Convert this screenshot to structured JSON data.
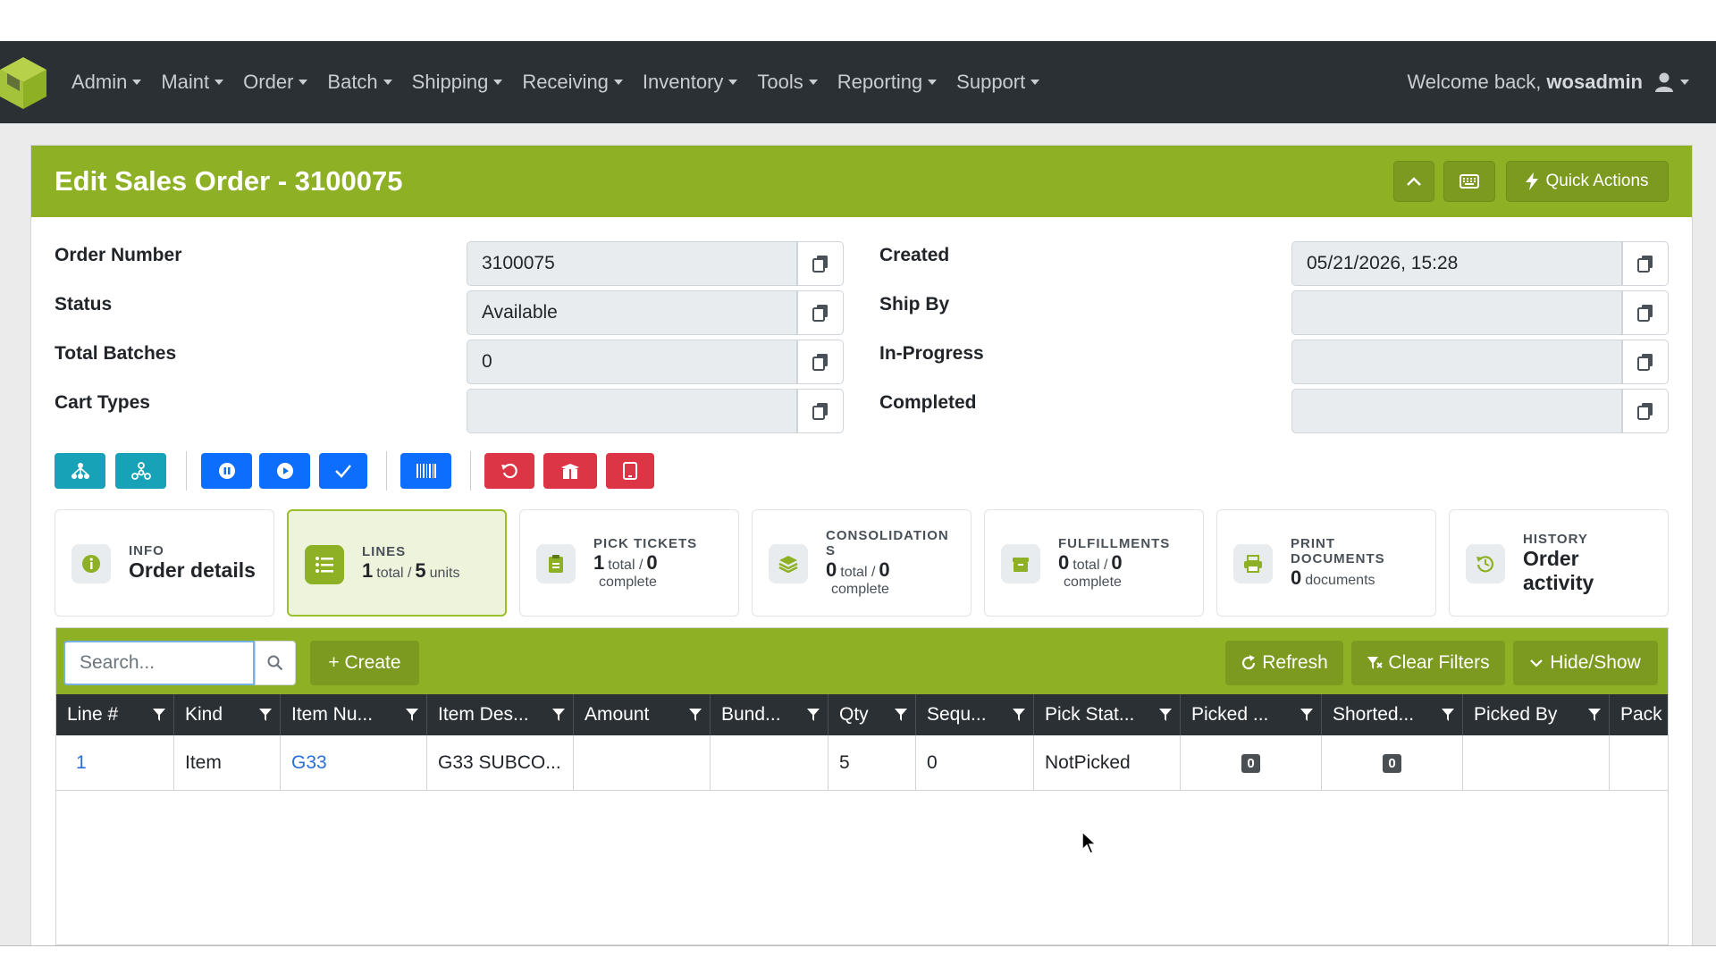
{
  "nav": {
    "items": [
      "Admin",
      "Maint",
      "Order",
      "Batch",
      "Shipping",
      "Receiving",
      "Inventory",
      "Tools",
      "Reporting",
      "Support"
    ],
    "welcome_prefix": "Welcome back,",
    "username": "wosadmin"
  },
  "card": {
    "title": "Edit Sales Order - 3100075",
    "quick_actions_label": "Quick Actions"
  },
  "fields": {
    "order_number": {
      "label": "Order Number",
      "value": "3100075"
    },
    "status": {
      "label": "Status",
      "value": "Available"
    },
    "total_batches": {
      "label": "Total Batches",
      "value": "0"
    },
    "cart_types": {
      "label": "Cart Types",
      "value": ""
    },
    "created": {
      "label": "Created",
      "value": "05/21/2026, 15:28"
    },
    "ship_by": {
      "label": "Ship By",
      "value": ""
    },
    "in_progress": {
      "label": "In-Progress",
      "value": ""
    },
    "completed": {
      "label": "Completed",
      "value": ""
    }
  },
  "action_buttons": {
    "teal": [
      "hierarchy-icon",
      "network-icon"
    ],
    "blue": [
      "pause-icon",
      "play-icon",
      "check-icon"
    ],
    "barcode": "barcode-icon",
    "red": [
      "undo-icon",
      "box-open-icon",
      "tablet-icon"
    ],
    "colors": {
      "teal": "#17a2b8",
      "blue": "#0d6efd",
      "red": "#dc3545",
      "brand": "#8db024"
    }
  },
  "stats": {
    "info": {
      "label": "INFO",
      "main": "Order details"
    },
    "lines": {
      "label": "LINES",
      "total": "1",
      "total_word": "total /",
      "units": "5",
      "units_word": "units"
    },
    "pick_tickets": {
      "label": "PICK TICKETS",
      "total": "1",
      "total_word": "total /",
      "complete": "0",
      "complete_word": "complete"
    },
    "consolidations": {
      "label_line1": "CONSOLIDATION",
      "label_line2": "S",
      "total": "0",
      "total_word": "total /",
      "complete": "0",
      "complete_word": "complete"
    },
    "fulfillments": {
      "label": "FULFILLMENTS",
      "total": "0",
      "total_word": "total /",
      "complete": "0",
      "complete_word": "complete"
    },
    "print_documents": {
      "label_line1": "PRINT",
      "label_line2": "DOCUMENTS",
      "count": "0",
      "count_word": "documents"
    },
    "history": {
      "label": "HISTORY",
      "main_line1": "Order",
      "main_line2": "activity"
    }
  },
  "grid": {
    "search_placeholder": "Search...",
    "create_label": "+ Create",
    "refresh_label": "Refresh",
    "clear_filters_label": "Clear Filters",
    "hide_show_label": "Hide/Show",
    "columns": [
      "Line #",
      "Kind",
      "Item Nu...",
      "Item Des...",
      "Amount",
      "Bund...",
      "Qty",
      "Sequ...",
      "Pick Stat...",
      "Picked ...",
      "Shorted...",
      "Picked By",
      "Pack"
    ],
    "rows": [
      {
        "line": "1",
        "kind": "Item",
        "item_number": "G33",
        "item_desc": "G33 SUBCO...",
        "amount": "",
        "bundle": "",
        "qty": "5",
        "sequence": "0",
        "pick_status": "NotPicked",
        "picked": "0",
        "shorted": "0",
        "picked_by": "",
        "pack": ""
      }
    ]
  }
}
